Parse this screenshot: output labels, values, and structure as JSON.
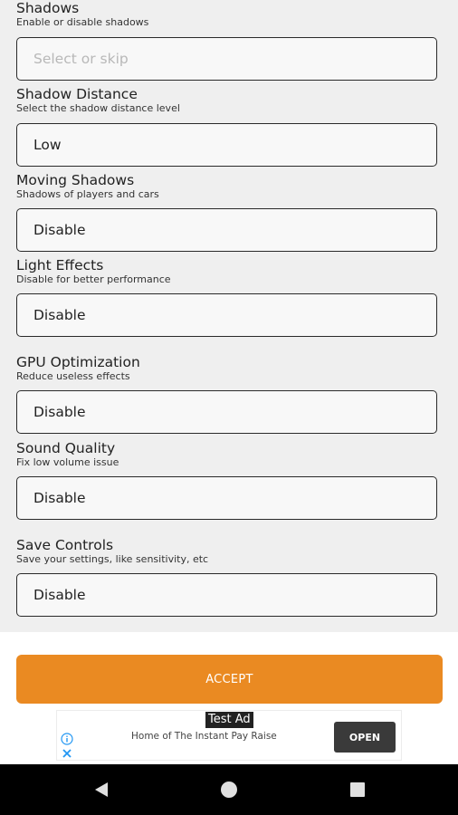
{
  "settings": [
    {
      "title": "Shadows",
      "desc": "Enable or disable shadows",
      "value": "",
      "placeholder": "Select or skip"
    },
    {
      "title": "Shadow Distance",
      "desc": "Select the shadow distance level",
      "value": "Low"
    },
    {
      "title": "Moving Shadows",
      "desc": "Shadows of players and cars",
      "value": "Disable"
    },
    {
      "title": "Light Effects",
      "desc": "Disable for better performance",
      "value": "Disable"
    },
    {
      "title": "GPU Optimization",
      "desc": "Reduce useless effects",
      "value": "Disable"
    },
    {
      "title": "Sound Quality",
      "desc": "Fix low volume issue",
      "value": "Disable"
    },
    {
      "title": "Save Controls",
      "desc": "Save your settings, like sensitivity, etc",
      "value": "Disable"
    }
  ],
  "accept_label": "ACCEPT",
  "ad": {
    "badge": "Test Ad",
    "text": "Home of The Instant Pay Raise",
    "open_label": "OPEN",
    "info_icon": "info-icon",
    "close_icon": "close-icon"
  },
  "nav": {
    "back_icon": "back-triangle-icon",
    "home_icon": "home-circle-icon",
    "recents_icon": "recents-square-icon"
  },
  "colors": {
    "accent": "#ea8a22",
    "background": "#efefef"
  }
}
